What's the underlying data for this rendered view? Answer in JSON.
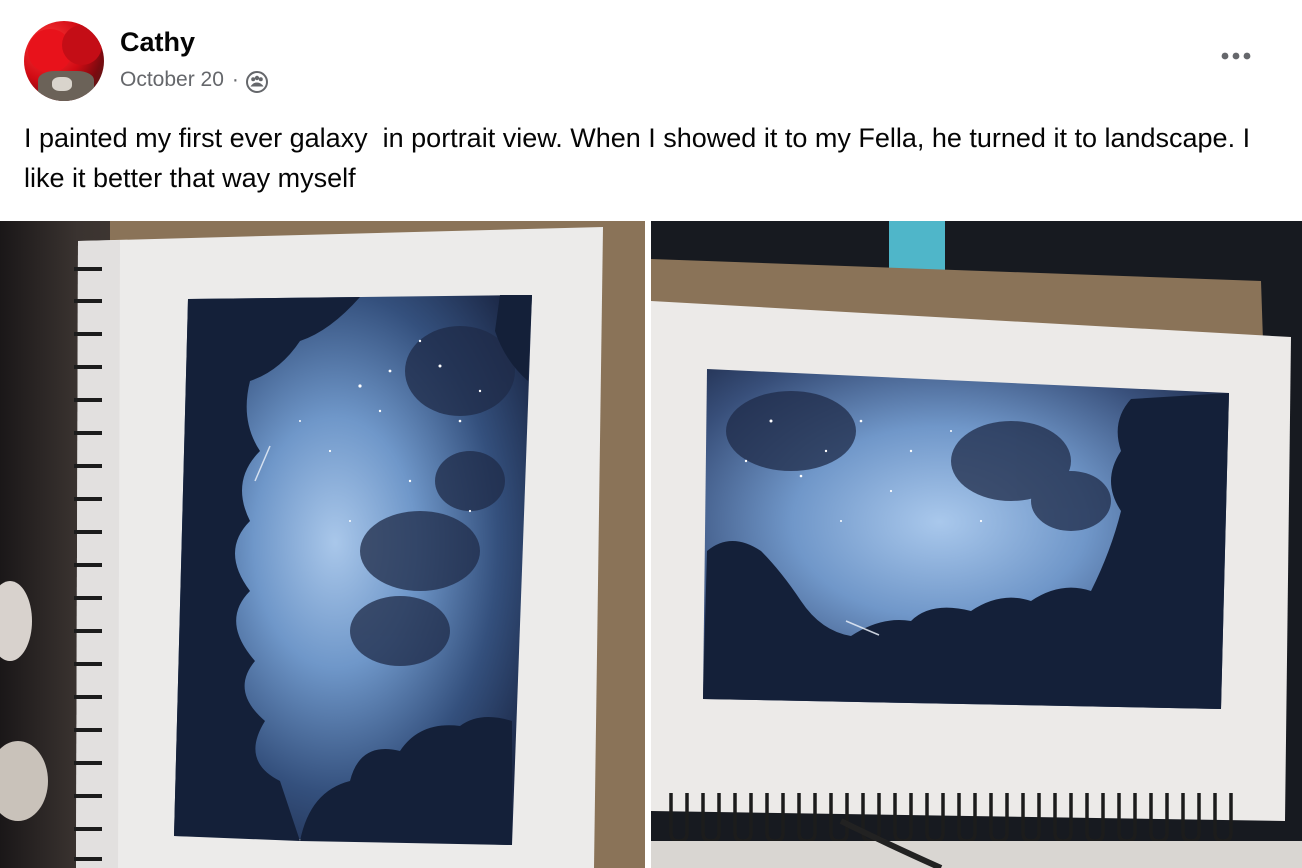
{
  "post": {
    "author": {
      "name": "Cathy"
    },
    "meta": {
      "date": "October 20",
      "separator": "·",
      "audience_icon": "friends-group-icon"
    },
    "menu_icon": "more-horizontal-icon",
    "text": "I painted my first ever galaxy  in portrait view. When I showed it to my Fella, he turned it to landscape. I like it better that way myself",
    "photos": [
      {
        "subject": "galaxy-watercolor-portrait"
      },
      {
        "subject": "galaxy-watercolor-landscape"
      }
    ]
  },
  "colors": {
    "primary_text": "#050505",
    "secondary_text": "#65676b",
    "galaxy_light": "#8fb4e0",
    "galaxy_dark": "#141d33",
    "kraft_board": "#8a7358"
  }
}
